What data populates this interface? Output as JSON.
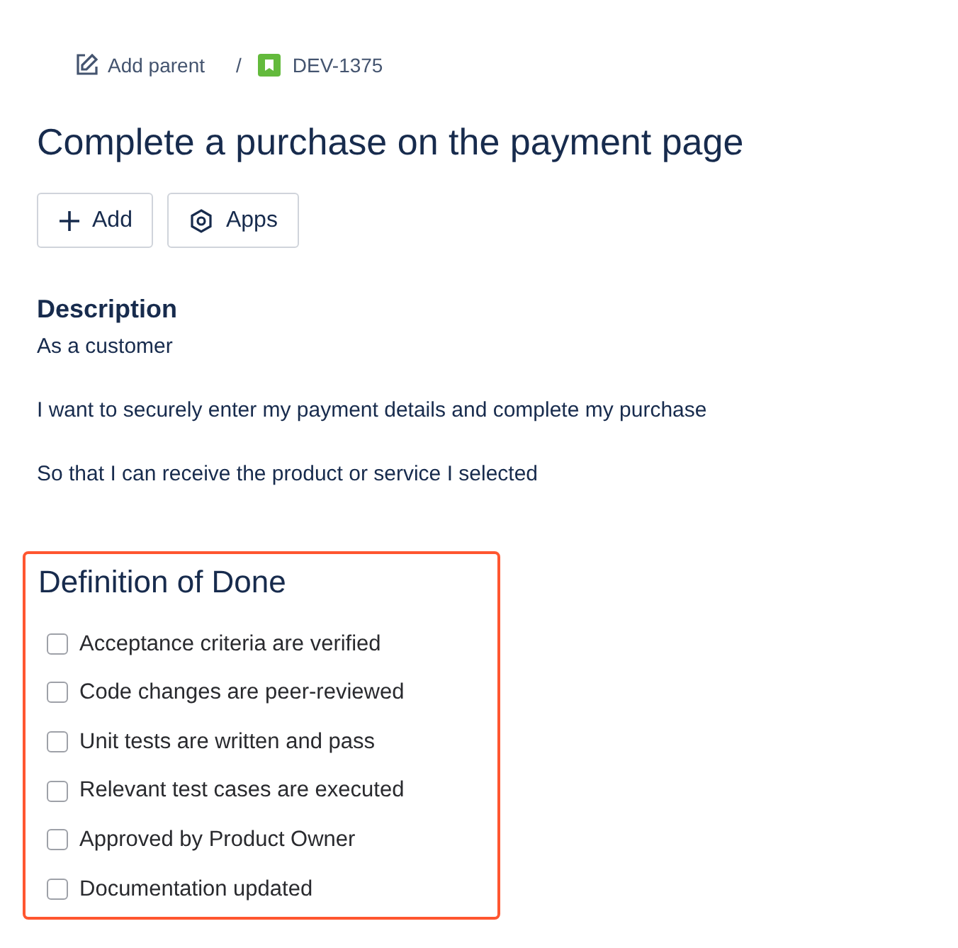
{
  "breadcrumb": {
    "parent_link": "Add parent",
    "separator": "/",
    "issue_key": "DEV-1375"
  },
  "title": "Complete a purchase on the payment page",
  "actions": [
    {
      "kind": "add",
      "label": "Add"
    },
    {
      "kind": "apps",
      "label": "Apps"
    }
  ],
  "description": {
    "heading": "Description",
    "paragraphs": [
      "As a customer",
      "I want to securely enter my payment details and complete my purchase",
      "So that I can receive the product or service I selected"
    ]
  },
  "definition_of_done": {
    "heading": "Definition of Done",
    "items": [
      {
        "label": "Acceptance criteria are verified",
        "checked": false
      },
      {
        "label": "Code changes are peer-reviewed",
        "checked": false
      },
      {
        "label": "Unit tests are written and pass",
        "checked": false
      },
      {
        "label": "Relevant test cases are executed",
        "checked": false
      },
      {
        "label": "Approved by Product Owner",
        "checked": false
      },
      {
        "label": "Documentation updated",
        "checked": false
      }
    ]
  }
}
